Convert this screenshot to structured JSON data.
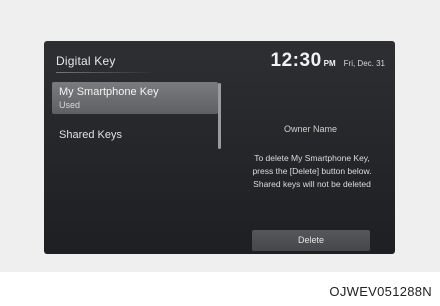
{
  "header": {
    "title": "Digital Key",
    "time": "12:30",
    "ampm": "PM",
    "date": "Fri, Dec. 31"
  },
  "sidebar": {
    "items": [
      {
        "label": "My Smartphone Key",
        "sub": "Used",
        "selected": true
      },
      {
        "label": "Shared Keys",
        "selected": false
      }
    ]
  },
  "detail": {
    "owner": "Owner Name",
    "message_lines": [
      "To delete My Smartphone Key,",
      "press the [Delete] button below.",
      "Shared keys will not be deleted"
    ],
    "delete_label": "Delete"
  },
  "caption": "OJWEV051288N",
  "colors": {
    "screen_bg": "#26282b",
    "selected_item": "#6e6f72",
    "button_bg": "#4d4f52"
  }
}
